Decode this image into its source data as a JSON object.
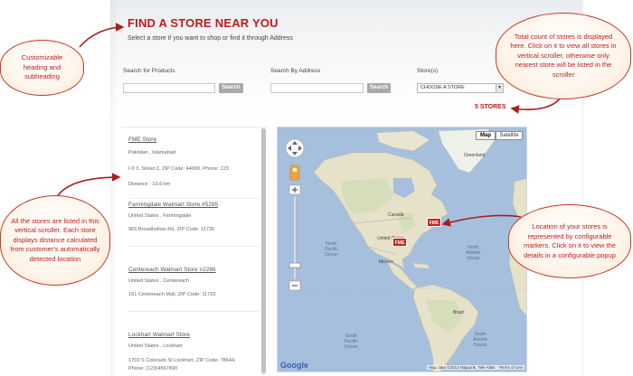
{
  "header": {
    "title": "FIND A STORE NEAR YOU",
    "subtitle": "Select a store if you want to shop or find it through Address"
  },
  "search": {
    "products_label": "Search for Products",
    "products_value": "",
    "products_button": "Search",
    "address_label": "Search By Address",
    "address_value": "",
    "address_button": "Search",
    "stores_label": "Store(s)",
    "stores_selected": "CHOOSE A STORE"
  },
  "store_count": "5 STORES",
  "stores": [
    {
      "name": "FME Store",
      "line1": "Pakistan , Islamabad",
      "line2": "I-9 3, Street 2, ZIP Code: 44000, Phone: 123",
      "line3": "Distance : 10.6 km"
    },
    {
      "name": "Farmingdale Walmart Store #5295",
      "line1": "United States , Farmingdale",
      "line2": "965 Broadhollow Rd, ZIP Code: 11735",
      "line3": ""
    },
    {
      "name": "Centereach Walmart Store #2286",
      "line1": "United States , Centereach",
      "line2": "161 Centereach Mall, ZIP Code: 11720",
      "line3": ""
    },
    {
      "name": "Lockhart Walmart Store",
      "line1": "United States , Lockhart",
      "line2": "1703 S Colorado St Lockhart, ZIP Code: 78644,",
      "line3": "Phone: (123)4567890"
    }
  ],
  "map": {
    "map_button": "Map",
    "satellite_button": "Satellite",
    "marker_label": "FME",
    "google_logo": "Google",
    "copyright": "Map data ©2012 MapLink, Tele Atlas · Terms of Use",
    "labels": {
      "north_pacific": "North\nPacific\nOcean",
      "north_atlantic": "North\nAtlantic\nOcean",
      "south_pacific": "South\nPacific\nOcean",
      "south_atlantic": "South\nAtlantic\nOcean",
      "canada": "Canada",
      "united_states": "United States",
      "mexico": "Mexico",
      "brazil": "Brazil",
      "greenland": "Greenland"
    }
  },
  "annotations": {
    "heading_note": "Customizable heading and subheading",
    "count_note": "Total count of stores is displayed here. Click on it to view all stores in vertical scroller, otherwise only nearest store will be listed in the scroller",
    "list_note": "All the stores are listed in this vertical scroller. Each store displays distance calculated from customer's automatically detected location",
    "marker_note": "Location of your stores is represented by configurable markers. Click on it to view the details in a configurable popup"
  },
  "colors": {
    "accent": "#c11a1a",
    "ocean": "#a5bfdd",
    "land": "#e6e1c9",
    "marker": "#c9251f"
  }
}
